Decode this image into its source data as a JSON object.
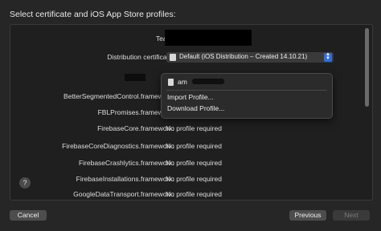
{
  "heading": "Select certificate and iOS App Store profiles:",
  "team_label": "Team:",
  "distribution_label": "Distribution certificate:",
  "distribution_value": "Default (iOS Distribution – Created 14.10.21)",
  "app_label": ".app",
  "menu": {
    "profile_name": "am",
    "items": [
      "Import Profile...",
      "Download Profile..."
    ]
  },
  "frameworks": [
    {
      "name": "BetterSegmentedControl.framework:",
      "value": ""
    },
    {
      "name": "FBLPromises.framework:",
      "value": ""
    },
    {
      "name": "FirebaseCore.framework:",
      "value": "No profile required"
    },
    {
      "name": "FirebaseCoreDiagnostics.framework:",
      "value": "No profile required"
    },
    {
      "name": "FirebaseCrashlytics.framework:",
      "value": "No profile required"
    },
    {
      "name": "FirebaseInstallations.framework:",
      "value": "No profile required"
    },
    {
      "name": "GoogleDataTransport.framework:",
      "value": "No profile required"
    }
  ],
  "help": "?",
  "buttons": {
    "cancel": "Cancel",
    "previous": "Previous",
    "next": "Next"
  }
}
